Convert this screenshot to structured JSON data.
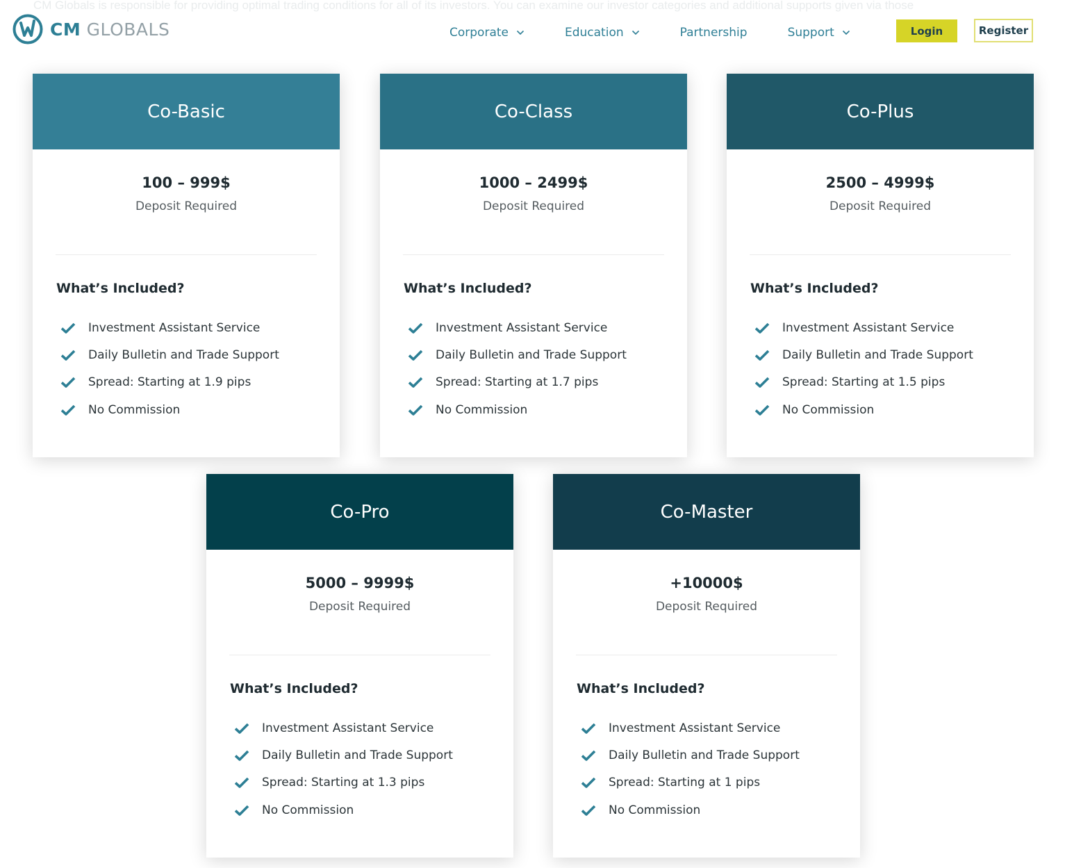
{
  "background_text": "CM Globals is responsible for providing optimal trading conditions for all of its investors. You can examine our investor categories and additional supports given via those",
  "logo": {
    "bold": "CM",
    "light": " GLOBALS"
  },
  "nav": {
    "items": [
      {
        "label": "Corporate",
        "has_dropdown": true
      },
      {
        "label": "Education",
        "has_dropdown": true
      },
      {
        "label": "Partnership",
        "has_dropdown": false
      },
      {
        "label": "Support",
        "has_dropdown": true
      }
    ],
    "login_label": "Login",
    "register_label": "Register"
  },
  "colors": {
    "accent": "#2f7f96",
    "login_bg": "#d6d427",
    "check": "#2d7f95"
  },
  "cards": [
    {
      "name": "Co-Basic",
      "header_color": "#347f96",
      "price": "100 – 999$",
      "price_label": "Deposit Required",
      "included_title": "What’s Included?",
      "features": [
        "Investment Assistant Service",
        "Daily Bulletin and Trade Support",
        "Spread: Starting at 1.9 pips",
        "No Commission"
      ]
    },
    {
      "name": "Co-Class",
      "header_color": "#2a7186",
      "price": "1000 – 2499$",
      "price_label": "Deposit Required",
      "included_title": "What’s Included?",
      "features": [
        "Investment Assistant Service",
        "Daily Bulletin and Trade Support",
        "Spread: Starting at 1.7 pips",
        "No Commission"
      ]
    },
    {
      "name": "Co-Plus",
      "header_color": "#205868",
      "price": "2500 – 4999$",
      "price_label": "Deposit Required",
      "included_title": "What’s Included?",
      "features": [
        "Investment Assistant Service",
        "Daily Bulletin and Trade Support",
        "Spread: Starting at 1.5 pips",
        "No Commission"
      ]
    },
    {
      "name": "Co-Pro",
      "header_color": "#03404b",
      "price": "5000 – 9999$",
      "price_label": "Deposit Required",
      "included_title": "What’s Included?",
      "features": [
        "Investment Assistant Service",
        "Daily Bulletin and Trade Support",
        "Spread: Starting at 1.3 pips",
        "No Commission"
      ]
    },
    {
      "name": "Co-Master",
      "header_color": "#123d4c",
      "price": "+10000$",
      "price_label": "Deposit Required",
      "included_title": "What’s Included?",
      "features": [
        "Investment Assistant Service",
        "Daily Bulletin and Trade Support",
        "Spread: Starting at 1 pips",
        "No Commission"
      ]
    }
  ]
}
